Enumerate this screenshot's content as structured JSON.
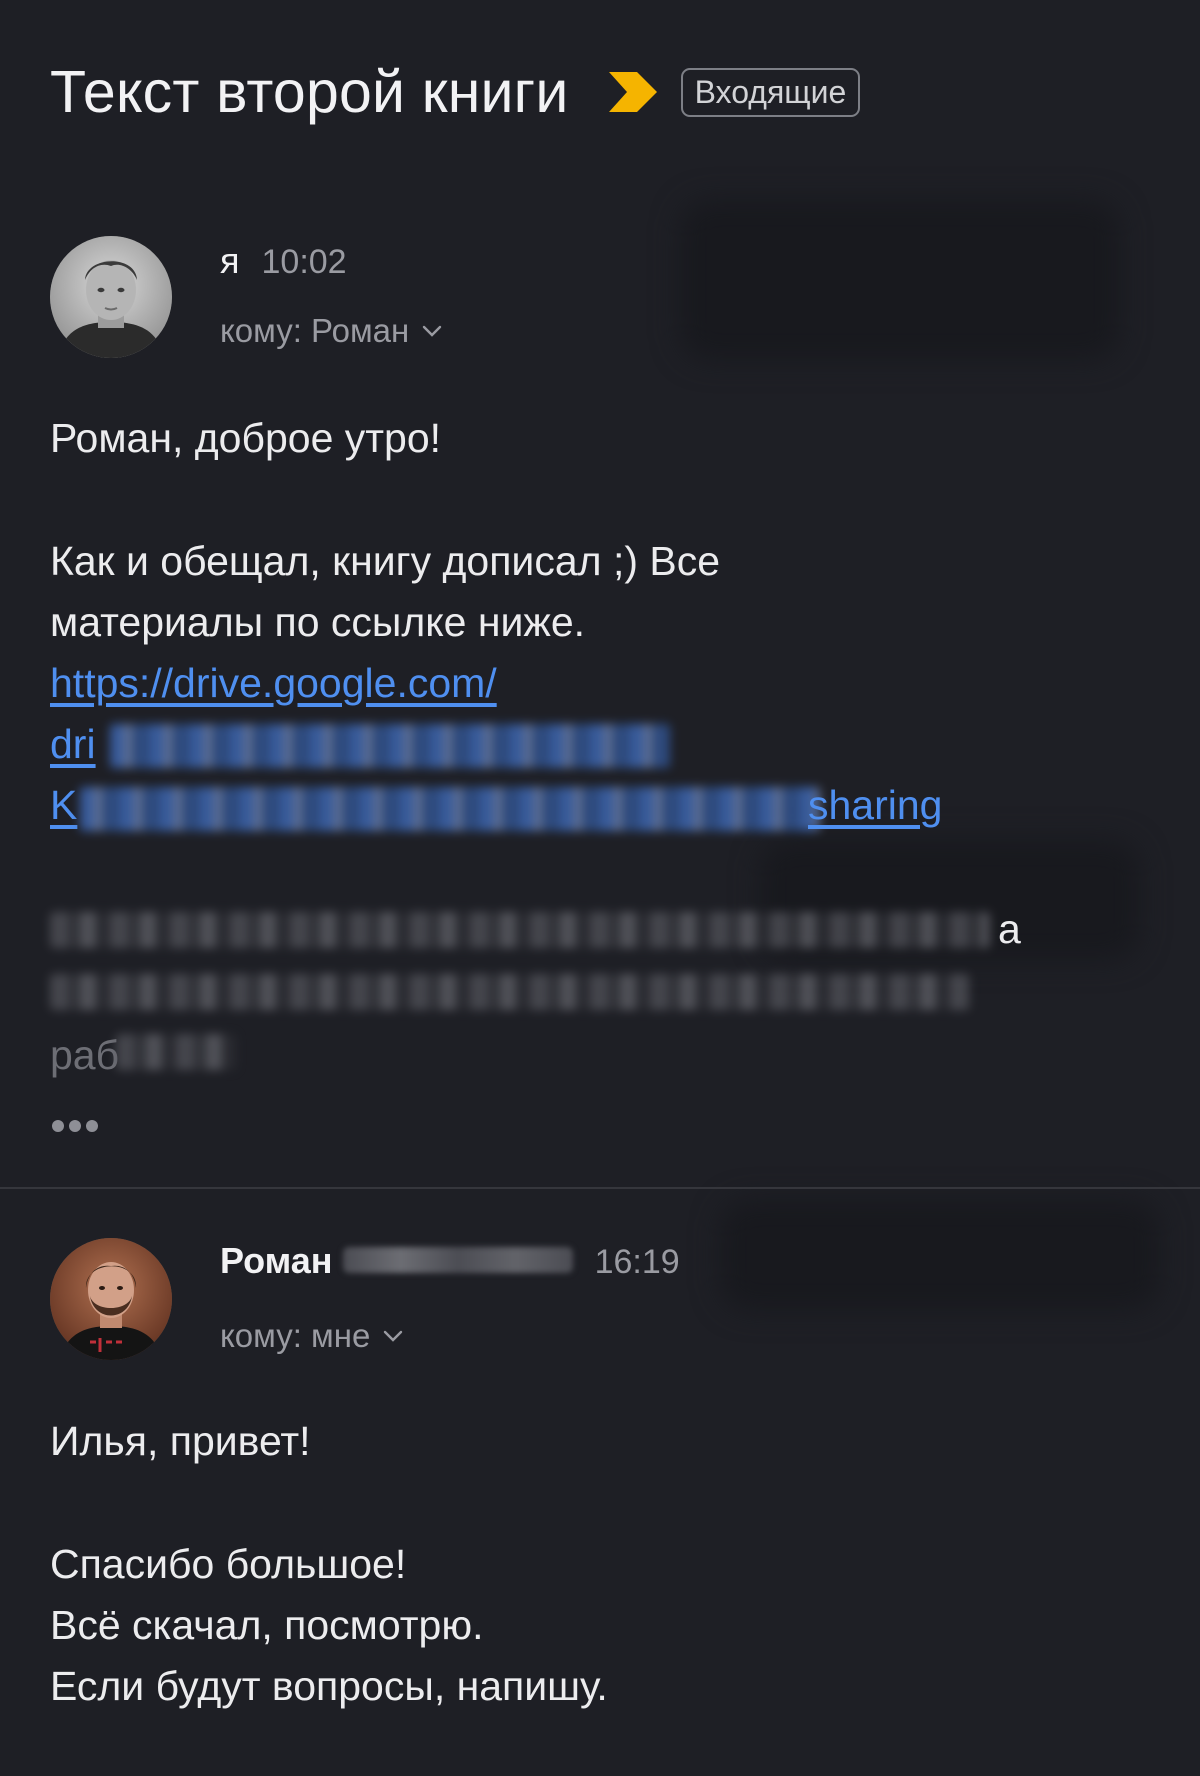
{
  "thread": {
    "subject": "Текст второй книги",
    "folder_badge": "Входящие",
    "important_icon": "important-marker-icon"
  },
  "messages": [
    {
      "sender": "я",
      "time": "10:02",
      "recipient_label": "кому: Роман",
      "avatar_icon": "user-avatar",
      "greeting": "Роман, доброе утро!",
      "body_line_1": "Как и обещал, книгу дописал ;) Все",
      "body_line_2": "материалы по ссылке ниже.",
      "link_line_1": "https://drive.google.com/",
      "link_line_2": "dri",
      "link_line_3": "K",
      "link_line_3_tail": "sharing",
      "trailing_visible_1": "а",
      "trailing_visible_3": "раб"
    },
    {
      "sender": "Роман",
      "time": "16:19",
      "recipient_label": "кому: мне",
      "avatar_icon": "user-avatar",
      "greeting": "Илья, привет!",
      "body_line_1": "Спасибо большое!",
      "body_line_2": "Всё скачал, посмотрю.",
      "body_line_3": "Если будут вопросы, напишу."
    }
  ],
  "colors": {
    "background": "#1e1f25",
    "accent_important": "#f5b400",
    "link": "#4f8ff0",
    "secondary_text": "#9a9ba2"
  }
}
